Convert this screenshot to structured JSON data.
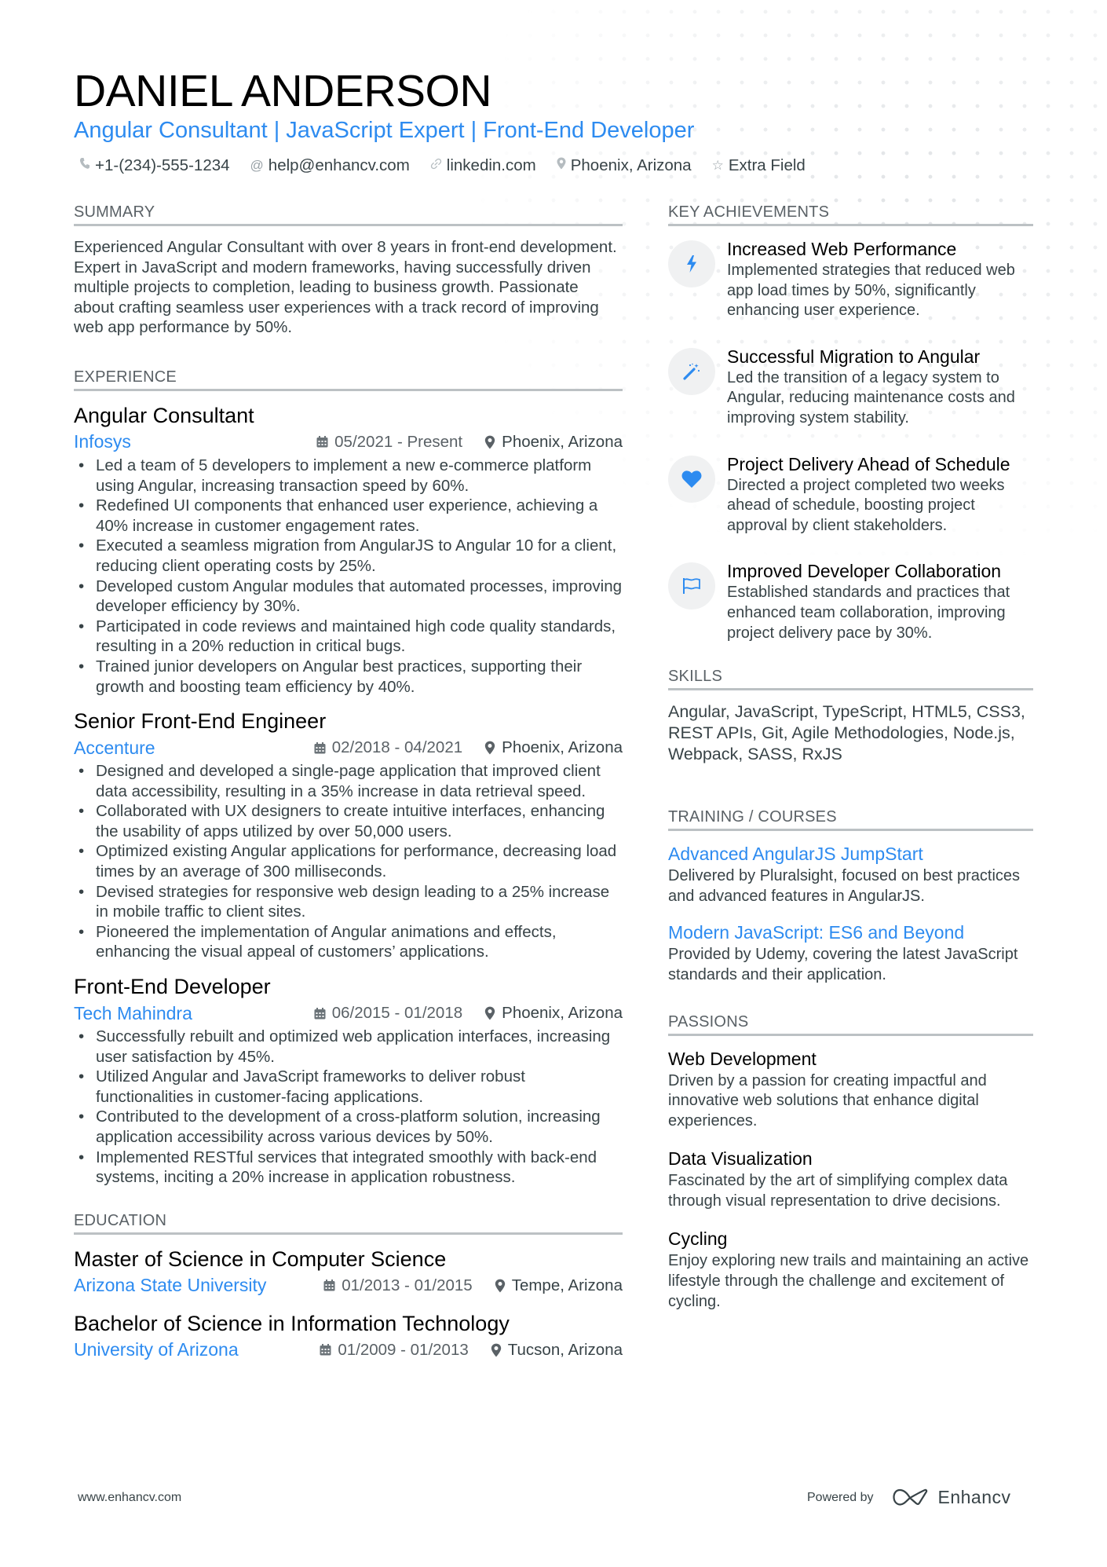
{
  "header": {
    "name": "DANIEL ANDERSON",
    "headline": "Angular Consultant | JavaScript Expert | Front-End Developer",
    "contacts": [
      {
        "icon": "phone-icon",
        "text": "+1-(234)-555-1234"
      },
      {
        "icon": "at-icon",
        "text": "help@enhancv.com"
      },
      {
        "icon": "link-icon",
        "text": "linkedin.com"
      },
      {
        "icon": "location-icon",
        "text": "Phoenix, Arizona"
      },
      {
        "icon": "star-icon",
        "text": "Extra Field"
      }
    ]
  },
  "summary": {
    "title": "SUMMARY",
    "text": "Experienced Angular Consultant with over 8 years in front-end development. Expert in JavaScript and modern frameworks, having successfully driven multiple projects to completion, leading to business growth. Passionate about crafting seamless user experiences with a track record of improving web app performance by 50%."
  },
  "experience": {
    "title": "EXPERIENCE",
    "jobs": [
      {
        "title": "Angular Consultant",
        "company": "Infosys",
        "dates": "05/2021 - Present",
        "location": "Phoenix, Arizona",
        "bullets": [
          "Led a team of 5 developers to implement a new e-commerce platform using Angular, increasing transaction speed by 60%.",
          "Redefined UI components that enhanced user experience, achieving a 40% increase in customer engagement rates.",
          "Executed a seamless migration from AngularJS to Angular 10 for a client, reducing client operating costs by 25%.",
          "Developed custom Angular modules that automated processes, improving developer efficiency by 30%.",
          "Participated in code reviews and maintained high code quality standards, resulting in a 20% reduction in critical bugs.",
          "Trained junior developers on Angular best practices, supporting their growth and boosting team efficiency by 40%."
        ]
      },
      {
        "title": "Senior Front-End Engineer",
        "company": "Accenture",
        "dates": "02/2018 - 04/2021",
        "location": "Phoenix, Arizona",
        "bullets": [
          "Designed and developed a single-page application that improved client data accessibility, resulting in a 35% increase in data retrieval speed.",
          "Collaborated with UX designers to create intuitive interfaces, enhancing the usability of apps utilized by over 50,000 users.",
          "Optimized existing Angular applications for performance, decreasing load times by an average of 300 milliseconds.",
          "Devised strategies for responsive web design leading to a 25% increase in mobile traffic to client sites.",
          "Pioneered the implementation of Angular animations and effects, enhancing the visual appeal of customers’ applications."
        ]
      },
      {
        "title": "Front-End Developer",
        "company": "Tech Mahindra",
        "dates": "06/2015 - 01/2018",
        "location": "Phoenix, Arizona",
        "bullets": [
          "Successfully rebuilt and optimized web application interfaces, increasing user satisfaction by 45%.",
          "Utilized Angular and JavaScript frameworks to deliver robust functionalities in customer-facing applications.",
          "Contributed to the development of a cross-platform solution, increasing application accessibility across various devices by 50%.",
          "Implemented RESTful services that integrated smoothly with back-end systems, inciting a 20% increase in application robustness."
        ]
      }
    ]
  },
  "education": {
    "title": "EDUCATION",
    "items": [
      {
        "degree": "Master of Science in Computer Science",
        "school": "Arizona State University",
        "dates": "01/2013 - 01/2015",
        "location": "Tempe, Arizona"
      },
      {
        "degree": "Bachelor of Science in Information Technology",
        "school": "University of Arizona",
        "dates": "01/2009 - 01/2013",
        "location": "Tucson, Arizona"
      }
    ]
  },
  "achievements": {
    "title": "KEY ACHIEVEMENTS",
    "items": [
      {
        "icon": "lightning-icon",
        "title": "Increased Web Performance",
        "desc": "Implemented strategies that reduced web app load times by 50%, significantly enhancing user experience."
      },
      {
        "icon": "magic-wand-icon",
        "title": "Successful Migration to Angular",
        "desc": "Led the transition of a legacy system to Angular, reducing maintenance costs and improving system stability."
      },
      {
        "icon": "heart-icon",
        "title": "Project Delivery Ahead of Schedule",
        "desc": "Directed a project completed two weeks ahead of schedule, boosting project approval by client stakeholders."
      },
      {
        "icon": "flag-icon",
        "title": "Improved Developer Collaboration",
        "desc": "Established standards and practices that enhanced team collaboration, improving project delivery pace by 30%."
      }
    ]
  },
  "skills": {
    "title": "SKILLS",
    "text": "Angular, JavaScript, TypeScript, HTML5, CSS3, REST APIs, Git, Agile Methodologies, Node.js, Webpack, SASS, RxJS"
  },
  "training": {
    "title": "TRAINING / COURSES",
    "items": [
      {
        "title": "Advanced AngularJS JumpStart",
        "desc": "Delivered by Pluralsight, focused on best practices and advanced features in AngularJS."
      },
      {
        "title": "Modern JavaScript: ES6 and Beyond",
        "desc": "Provided by Udemy, covering the latest JavaScript standards and their application."
      }
    ]
  },
  "passions": {
    "title": "PASSIONS",
    "items": [
      {
        "title": "Web Development",
        "desc": "Driven by a passion for creating impactful and innovative web solutions that enhance digital experiences."
      },
      {
        "title": "Data Visualization",
        "desc": "Fascinated by the art of simplifying complex data through visual representation to drive decisions."
      },
      {
        "title": "Cycling",
        "desc": "Enjoy exploring new trails and maintaining an active lifestyle through the challenge and excitement of cycling."
      }
    ]
  },
  "footer": {
    "website": "www.enhancv.com",
    "powered_by": "Powered by",
    "brand": "Enhancv"
  },
  "colors": {
    "accent": "#2d8bf0",
    "text": "#384347",
    "heading": "#000000",
    "rule": "#bcc1c4"
  }
}
